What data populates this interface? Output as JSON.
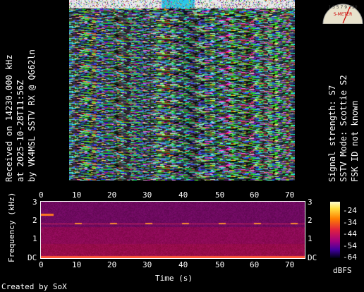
{
  "left_caption": {
    "line1": "Received on  14230.000 kHz",
    "line2": "at 2025-10-28T11:56Z",
    "line3": "by VK4MSL SSTV RX @ QG62ln"
  },
  "right_caption": {
    "line1": "Signal strength: S7",
    "line2": "SSTV Mode: Scottie S2",
    "line3": "FSK ID not known"
  },
  "spectrogram": {
    "x_ticks": [
      "0",
      "10",
      "20",
      "30",
      "40",
      "50",
      "60",
      "70"
    ],
    "y_ticks": [
      "3",
      "2",
      "1",
      "DC"
    ],
    "right_ticks": [
      "3",
      "2",
      "1",
      "DC"
    ],
    "ylabel": "Frequency (kHz)",
    "xlabel": "Time (s)"
  },
  "colorbar": {
    "ticks": [
      "-24",
      "-34",
      "-44",
      "-54",
      "-64"
    ],
    "label": "dBFS"
  },
  "footer": {
    "credit": "Created by SoX"
  },
  "meter": {
    "scale_text": "1 3 5 7 9 +20",
    "label": "S-METER",
    "level": "S7"
  },
  "colors": {
    "background": "#000000",
    "spectrum_base": "#7a0a5a",
    "band_line": "#ff5a3a"
  }
}
